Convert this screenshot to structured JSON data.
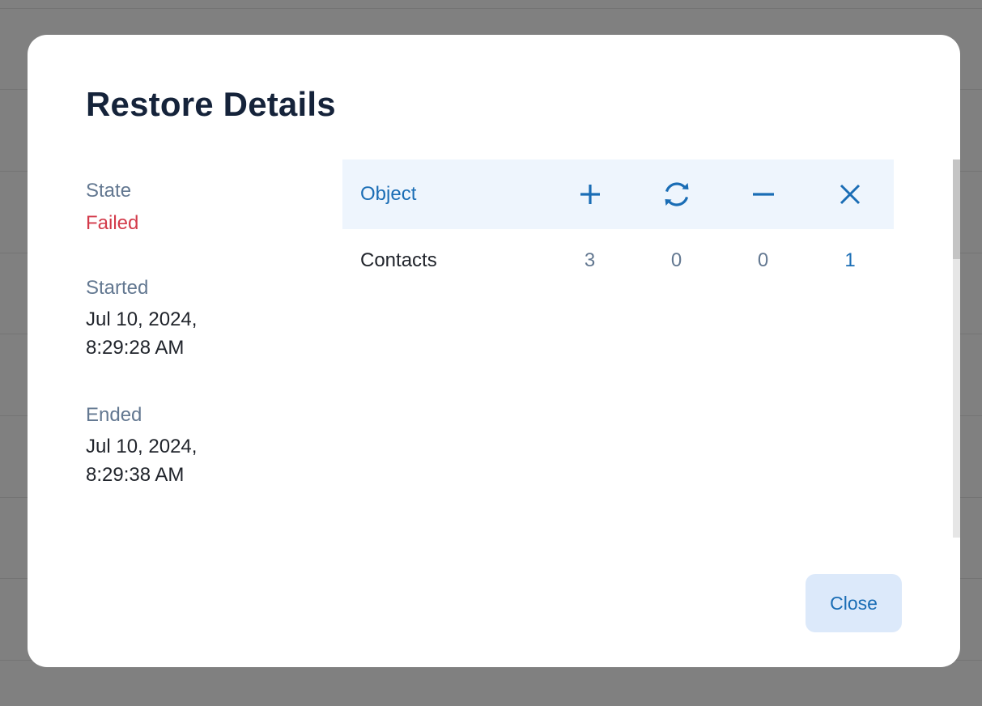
{
  "dialog": {
    "title": "Restore Details",
    "close_label": "Close"
  },
  "details": {
    "state_label": "State",
    "state_value": "Failed",
    "started_label": "Started",
    "started_date": "Jul 10, 2024,",
    "started_time": "8:29:28 AM",
    "ended_label": "Ended",
    "ended_date": "Jul 10, 2024,",
    "ended_time": "8:29:38 AM"
  },
  "table": {
    "header_object": "Object",
    "header_icons": [
      "plus-icon",
      "sync-icon",
      "minus-icon",
      "close-x-icon"
    ],
    "rows": [
      {
        "object": "Contacts",
        "added": "3",
        "updated": "0",
        "removed": "0",
        "failed": "1"
      }
    ]
  },
  "colors": {
    "accent": "#1a6db5",
    "failed": "#d33a4a",
    "header_bg": "#eef5fd",
    "button_bg": "#dce9fa",
    "title": "#15233a",
    "muted": "#637891"
  }
}
